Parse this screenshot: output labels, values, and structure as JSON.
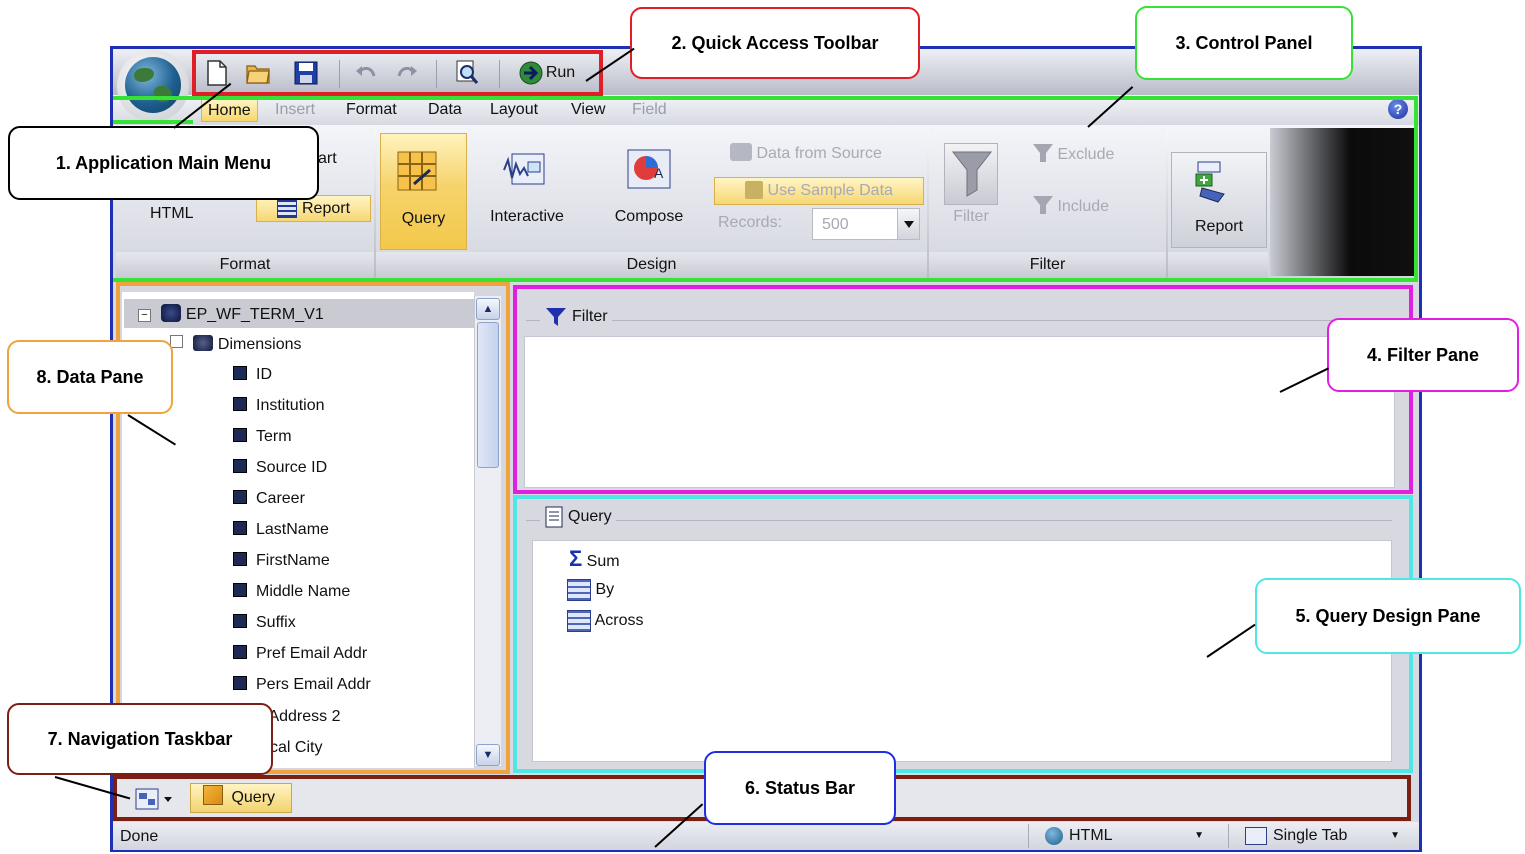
{
  "callouts": {
    "app_main_menu": "1. Application Main Menu",
    "quick_access": "2. Quick Access Toolbar",
    "control_panel": "3. Control Panel",
    "filter_pane": "4. Filter Pane",
    "query_design": "5. Query Design Pane",
    "status_bar": "6. Status Bar",
    "nav_taskbar": "7. Navigation Taskbar",
    "data_pane": "8. Data Pane"
  },
  "quick_toolbar": {
    "run_label": "Run",
    "icons": [
      "new-document-icon",
      "open-folder-icon",
      "save-icon",
      "undo-icon",
      "redo-icon",
      "preview-icon",
      "run-icon"
    ]
  },
  "menu": {
    "tabs": [
      {
        "label": "Home",
        "state": "active"
      },
      {
        "label": "Insert",
        "state": "disabled"
      },
      {
        "label": "Format",
        "state": "normal"
      },
      {
        "label": "Data",
        "state": "normal"
      },
      {
        "label": "Layout",
        "state": "normal"
      },
      {
        "label": "View",
        "state": "normal"
      },
      {
        "label": "Field",
        "state": "disabled"
      }
    ],
    "help": "?"
  },
  "ribbon": {
    "format": {
      "chart_partial": "art",
      "html_label": "HTML",
      "report_label": "Report",
      "group_label": "Format"
    },
    "design": {
      "query_label": "Query",
      "interactive_label": "Interactive",
      "compose_label": "Compose",
      "data_from_source": "Data from Source",
      "use_sample_data": "Use Sample Data",
      "records_label": "Records:",
      "records_value": "500",
      "group_label": "Design"
    },
    "filter": {
      "filter_label": "Filter",
      "exclude_label": "Exclude",
      "include_label": "Include",
      "group_label": "Filter"
    },
    "report_label": "Report"
  },
  "data_pane": {
    "root": "EP_WF_TERM_V1",
    "dimensions": "Dimensions",
    "fields": [
      "ID",
      "Institution",
      "Term",
      "Source ID",
      "Career",
      "LastName",
      "FirstName",
      "Middle Name",
      "Suffix",
      "Pref Email Addr",
      "Pers Email Addr"
    ],
    "partial_fields": [
      "d Address 2",
      "cal City"
    ]
  },
  "filter_pane": {
    "title": "Filter"
  },
  "query_pane": {
    "title": "Query",
    "items": [
      "Sum",
      "By",
      "Across"
    ]
  },
  "nav_taskbar": {
    "tab_label": "Query"
  },
  "status": {
    "text": "Done",
    "output_format": "HTML",
    "layout_mode": "Single Tab"
  },
  "colors": {
    "app_border": "#1d2fb5",
    "main_menu": "#000000",
    "quick_access": "#e01e25",
    "control_panel": "#37e237",
    "filter_pane": "#e11fe3",
    "query_pane": "#4fe6e6",
    "status_bar": "#1f2ee0",
    "nav_taskbar": "#7a1f12",
    "data_pane": "#f0a23c"
  }
}
